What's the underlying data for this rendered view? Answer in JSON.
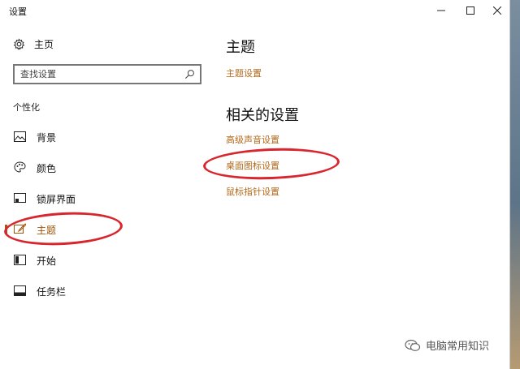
{
  "window": {
    "title": "设置",
    "controls": {
      "minimize": "—",
      "maximize": "☐",
      "close": "✕"
    }
  },
  "sidebar": {
    "home_label": "主页",
    "search_placeholder": "查找设置",
    "section_label": "个性化",
    "items": [
      {
        "label": "背景",
        "icon": "picture-icon",
        "active": false
      },
      {
        "label": "颜色",
        "icon": "palette-icon",
        "active": false
      },
      {
        "label": "锁屏界面",
        "icon": "lock-screen-icon",
        "active": false
      },
      {
        "label": "主题",
        "icon": "theme-brush-icon",
        "active": true
      },
      {
        "label": "开始",
        "icon": "start-grid-icon",
        "active": false
      },
      {
        "label": "任务栏",
        "icon": "taskbar-icon",
        "active": false
      }
    ]
  },
  "main": {
    "heading": "主题",
    "theme_settings_link": "主题设置",
    "related_heading": "相关的设置",
    "related_links": [
      "高级声音设置",
      "桌面图标设置",
      "鼠标指针设置"
    ]
  },
  "watermark": {
    "text": "电脑常用知识",
    "icon": "wechat-icon"
  },
  "colors": {
    "accent": "#b3691a",
    "annotation": "#d8262e",
    "window_bg": "#ffffff"
  }
}
